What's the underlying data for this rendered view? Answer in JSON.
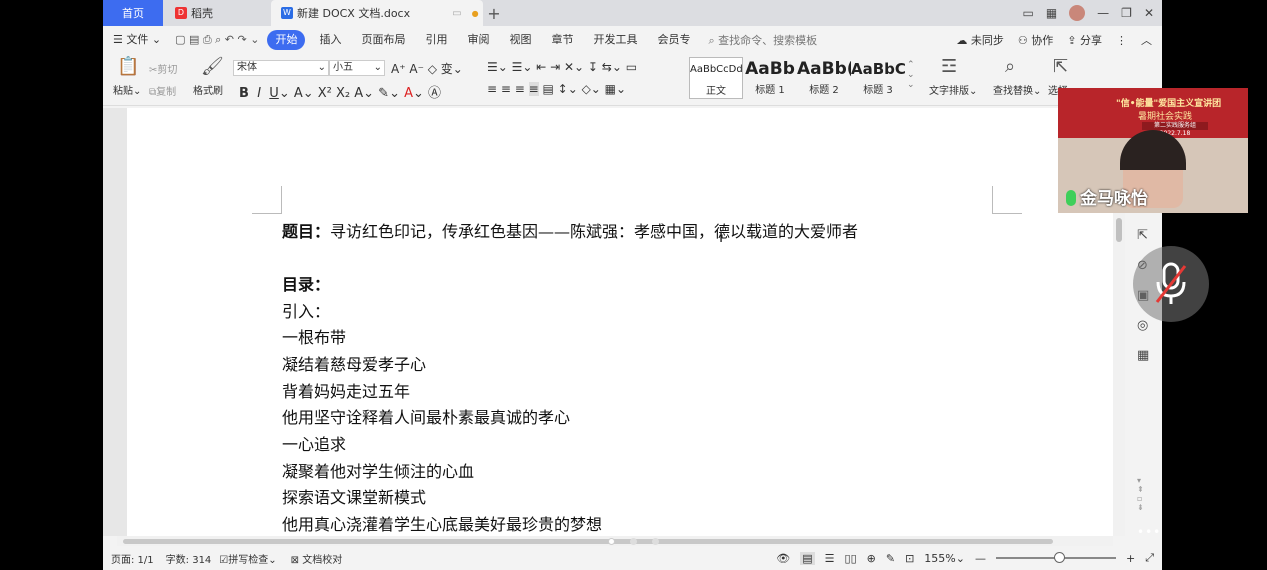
{
  "tabs": {
    "home": "首页",
    "daoke": "稻壳",
    "doc": "新建 DOCX 文档.docx",
    "doc_dot": "●",
    "plus": "+"
  },
  "menu": {
    "file": "文件",
    "items": [
      "开始",
      "插入",
      "页面布局",
      "引用",
      "审阅",
      "视图",
      "章节",
      "开发工具",
      "会员专"
    ],
    "search": "查找命令、搜索模板",
    "sync": "未同步",
    "collab": "协作",
    "share": "分享"
  },
  "ribbon": {
    "paste": "粘贴",
    "cut": "剪切",
    "copy": "复制",
    "format_painter": "格式刷",
    "font_name": "宋体",
    "font_size": "小五",
    "styles": [
      {
        "sample": "AaBbCcDd",
        "label": "正文"
      },
      {
        "sample": "AaBb",
        "label": "标题 1"
      },
      {
        "sample": "AaBb(",
        "label": "标题 2"
      },
      {
        "sample": "AaBbC",
        "label": "标题 3"
      }
    ],
    "text_layout": "文字排版",
    "find_replace": "查找替换",
    "select": "选择"
  },
  "document": {
    "title_label": "题目：",
    "title_text": "寻访红色印记，传承红色基因——陈斌强：孝感中国，德以载道的大爱师者",
    "toc_label": "目录：",
    "lines": [
      "引入：",
      "一根布带",
      "凝结着慈母爱孝子心",
      "背着妈妈走过五年",
      "他用坚守诠释着人间最朴素最真诚的孝心",
      "一心追求",
      "凝聚着他对学生倾注的心血",
      "探索语文课堂新模式",
      "他用真心浇灌着学生心底最美好最珍贵的梦想"
    ]
  },
  "status": {
    "page": "页面: 1/1",
    "words": "字数: 314",
    "spell": "拼写检查",
    "proof": "文档校对",
    "zoom": "155%"
  },
  "video": {
    "banner_line1": "\"信•能量\"爱国主义宣讲团",
    "banner_line2": "暑期社会实践",
    "banner_line3": "第二实践服务组2022.7.18",
    "name": "金马咏怡"
  }
}
